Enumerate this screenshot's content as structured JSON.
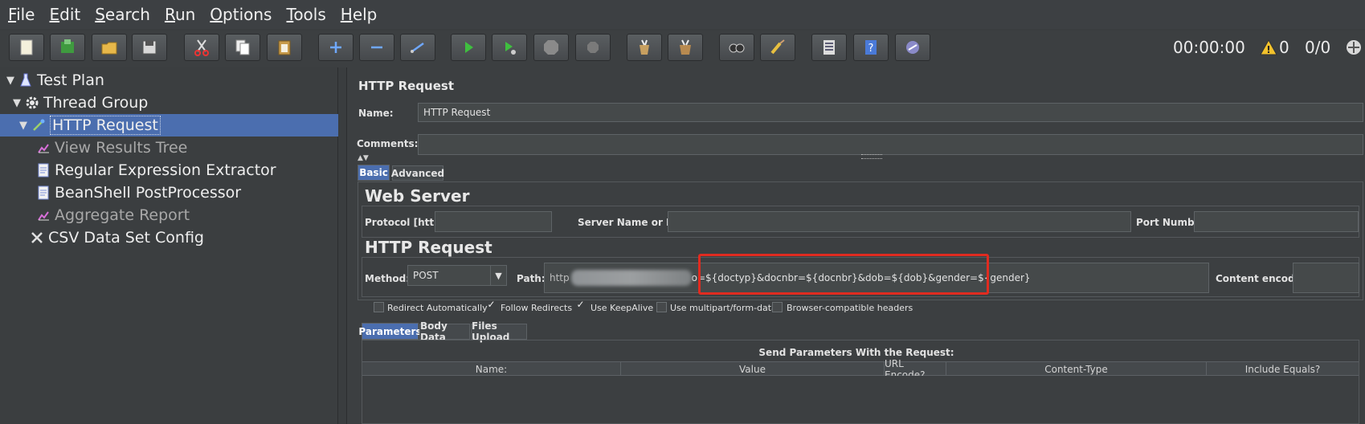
{
  "menu": [
    {
      "mnemonic": "F",
      "rest": "ile"
    },
    {
      "mnemonic": "E",
      "rest": "dit"
    },
    {
      "mnemonic": "S",
      "rest": "earch"
    },
    {
      "mnemonic": "R",
      "rest": "un"
    },
    {
      "mnemonic": "O",
      "rest": "ptions"
    },
    {
      "mnemonic": "T",
      "rest": "ools"
    },
    {
      "mnemonic": "H",
      "rest": "elp"
    }
  ],
  "toolbar": {
    "icons": [
      "new-icon",
      "templates-icon",
      "open-icon",
      "save-icon",
      "cut-icon",
      "copy-icon",
      "paste-icon",
      "expand-icon",
      "collapse-icon",
      "toggle-icon",
      "start-icon",
      "start-no-pause-icon",
      "stop-icon",
      "shutdown-icon",
      "clear-icon",
      "clear-all-icon",
      "search-icon",
      "reset-search-icon",
      "function-helper-icon",
      "help-icon",
      "remote-icon"
    ],
    "timer": "00:00:00",
    "warning_count": "0",
    "threads": "0/0"
  },
  "tree": {
    "items": [
      {
        "label": "Test Plan",
        "icon": "flask-icon"
      },
      {
        "label": "Thread Group",
        "icon": "gear-icon"
      },
      {
        "label": "HTTP Request",
        "icon": "pipette-icon"
      },
      {
        "label": "View Results Tree",
        "icon": "chart-icon"
      },
      {
        "label": "Regular Expression Extractor",
        "icon": "document-icon"
      },
      {
        "label": "BeanShell PostProcessor",
        "icon": "document-icon"
      },
      {
        "label": "Aggregate Report",
        "icon": "chart-icon"
      },
      {
        "label": "CSV Data Set Config",
        "icon": "tools-icon"
      }
    ]
  },
  "panel": {
    "title": "HTTP Request",
    "name_label": "Name:",
    "name_value": "HTTP Request",
    "comments_label": "Comments:",
    "tabs": [
      "Basic",
      "Advanced"
    ],
    "web_server": {
      "title": "Web Server",
      "protocol_label": "Protocol [http]:",
      "server_label": "Server Name or IP:",
      "port_label": "Port Number:"
    },
    "http_request": {
      "title": "HTTP Request",
      "method_label": "Method:",
      "method_value": "POST",
      "path_label": "Path:",
      "path_prefix": "http",
      "path_value": "o=${doctyp}&docnbr=${docnbr}&dob=${dob}&gender=${gender}",
      "content_encoding_label": "Content encoding:"
    },
    "checkboxes": [
      {
        "label": "Redirect Automatically",
        "checked": false
      },
      {
        "label": "Follow Redirects",
        "checked": true
      },
      {
        "label": "Use KeepAlive",
        "checked": true
      },
      {
        "label": "Use multipart/form-data",
        "checked": false
      },
      {
        "label": "Browser-compatible headers",
        "checked": false
      }
    ],
    "sub_tabs": [
      "Parameters",
      "Body Data",
      "Files Upload"
    ],
    "params_title": "Send Parameters With the Request:",
    "columns": [
      "Name:",
      "Value",
      "URL Encode?",
      "Content-Type",
      "Include Equals?"
    ]
  },
  "colors": {
    "highlight_red": "#e02b20",
    "selection_blue": "#4b6eaf"
  }
}
